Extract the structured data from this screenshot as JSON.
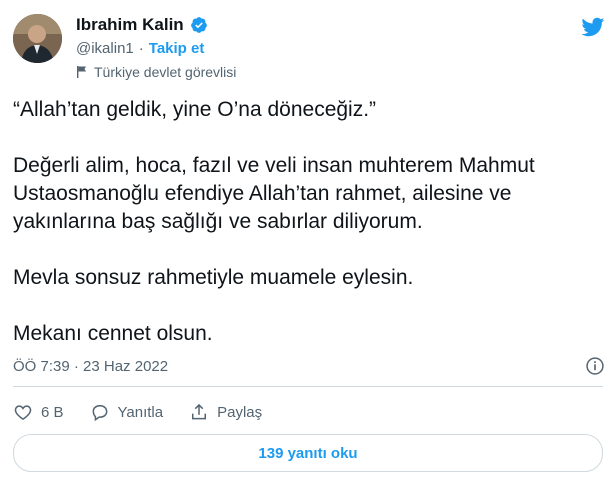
{
  "author": {
    "name": "Ibrahim Kalin",
    "handle": "@ikalin1",
    "separator": "·",
    "follow_label": "Takip et",
    "account_label": "Türkiye devlet görevlisi"
  },
  "tweet": {
    "paragraphs": [
      "“Allah’tan geldik, yine O’na döneceğiz.”",
      "Değerli alim, hoca, fazıl ve veli insan muhterem Mahmut\nUstaosmanoğlu efendiye Allah’tan rahmet, ailesine ve\nyakınlarına baş sağlığı ve sabırlar diliyorum.",
      "Mevla sonsuz rahmetiyle muamele eylesin.",
      "Mekanı cennet olsun."
    ],
    "timestamp": "ÖÖ 7:39 · 23 Haz 2022"
  },
  "actions": {
    "like_count": "6 B",
    "reply_label": "Yanıtla",
    "share_label": "Paylaş"
  },
  "read_replies_label": "139 yanıtı oku",
  "colors": {
    "accent": "#1d9bf0",
    "text": "#0f1419",
    "muted": "#536471",
    "border": "#cfd9de"
  },
  "icons": [
    "verified-badge-icon",
    "twitter-bird-icon",
    "flag-icon",
    "info-icon",
    "heart-icon",
    "reply-icon",
    "share-icon"
  ]
}
